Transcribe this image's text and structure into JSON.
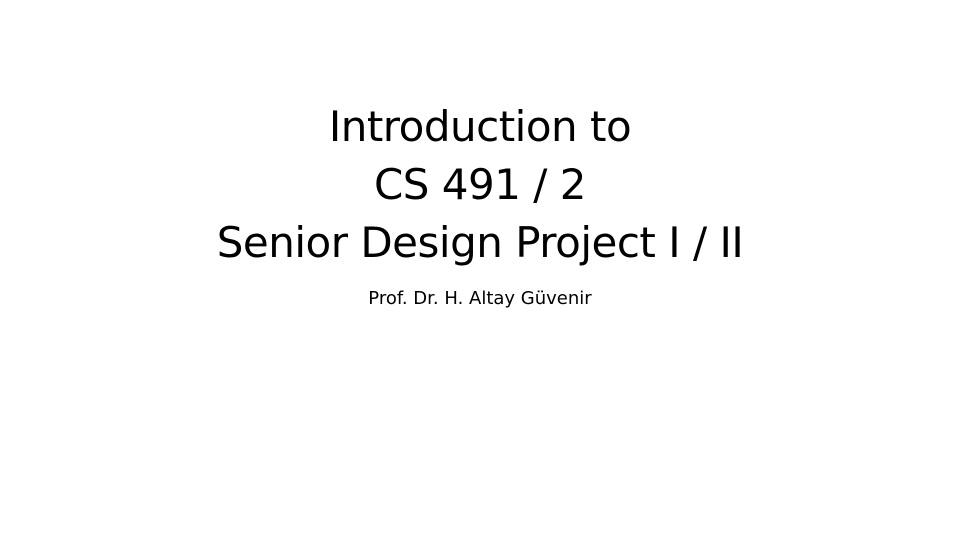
{
  "slide": {
    "title_lines": [
      "Introduction to",
      "CS 491 / 2",
      "Senior Design Project I / II"
    ],
    "subtitle": "Prof. Dr. H. Altay Güvenir"
  },
  "colors": {
    "background": "#ffffff",
    "text": "#000000"
  }
}
